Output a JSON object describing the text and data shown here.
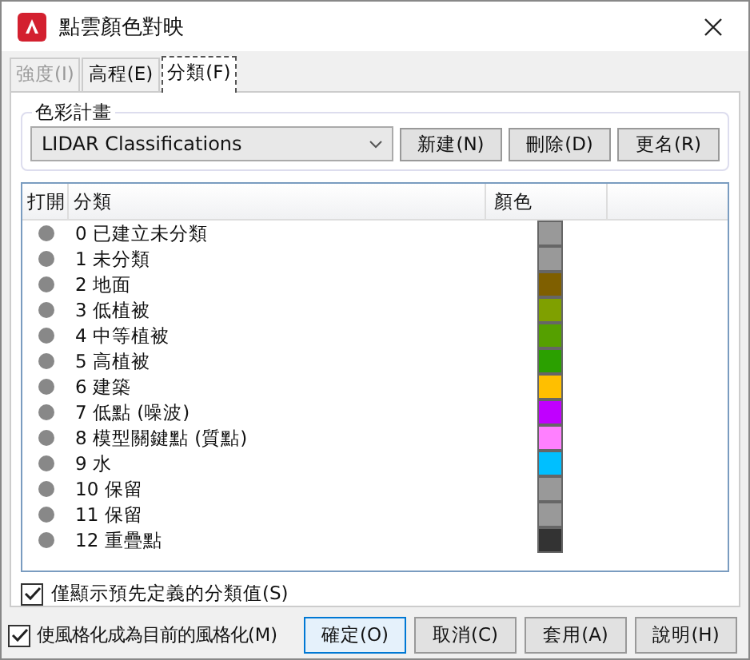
{
  "window": {
    "title": "點雲顏色對映"
  },
  "tabs": [
    {
      "label": "強度(I)",
      "selected": false,
      "disabled": true
    },
    {
      "label": "高程(E)",
      "selected": false,
      "disabled": false
    },
    {
      "label": "分類(F)",
      "selected": true,
      "disabled": false
    }
  ],
  "color_scheme": {
    "label": "色彩計畫",
    "value": "LIDAR Classifications",
    "buttons": [
      "新建(N)",
      "刪除(D)",
      "更名(R)"
    ]
  },
  "table": {
    "columns": [
      "打開",
      "分類",
      "顏色"
    ],
    "rows": [
      {
        "classification": "0 已建立未分類",
        "color": "#999999"
      },
      {
        "classification": "1 未分類",
        "color": "#999999"
      },
      {
        "classification": "2 地面",
        "color": "#7f5f00"
      },
      {
        "classification": "3 低植被",
        "color": "#7fa000"
      },
      {
        "classification": "4 中等植被",
        "color": "#55a000"
      },
      {
        "classification": "5 高植被",
        "color": "#2ba000"
      },
      {
        "classification": "6 建築",
        "color": "#ffbf00"
      },
      {
        "classification": "7 低點 (噪波)",
        "color": "#c000ff"
      },
      {
        "classification": "8 模型關鍵點 (質點)",
        "color": "#ff80ff"
      },
      {
        "classification": "9 水",
        "color": "#00bfff"
      },
      {
        "classification": "10 保留",
        "color": "#999999"
      },
      {
        "classification": "11 保留",
        "color": "#999999"
      },
      {
        "classification": "12 重疊點",
        "color": "#333333"
      }
    ]
  },
  "predefined_only": {
    "label": "僅顯示預先定義的分類值(S)",
    "checked": true
  },
  "make_current": {
    "label": "使風格化成為目前的風格化(M)",
    "checked": true
  },
  "buttons": [
    {
      "label": "確定(O)",
      "default": true
    },
    {
      "label": "取消(C)",
      "default": false
    },
    {
      "label": "套用(A)",
      "default": false
    },
    {
      "label": "說明(H)",
      "default": false
    }
  ]
}
